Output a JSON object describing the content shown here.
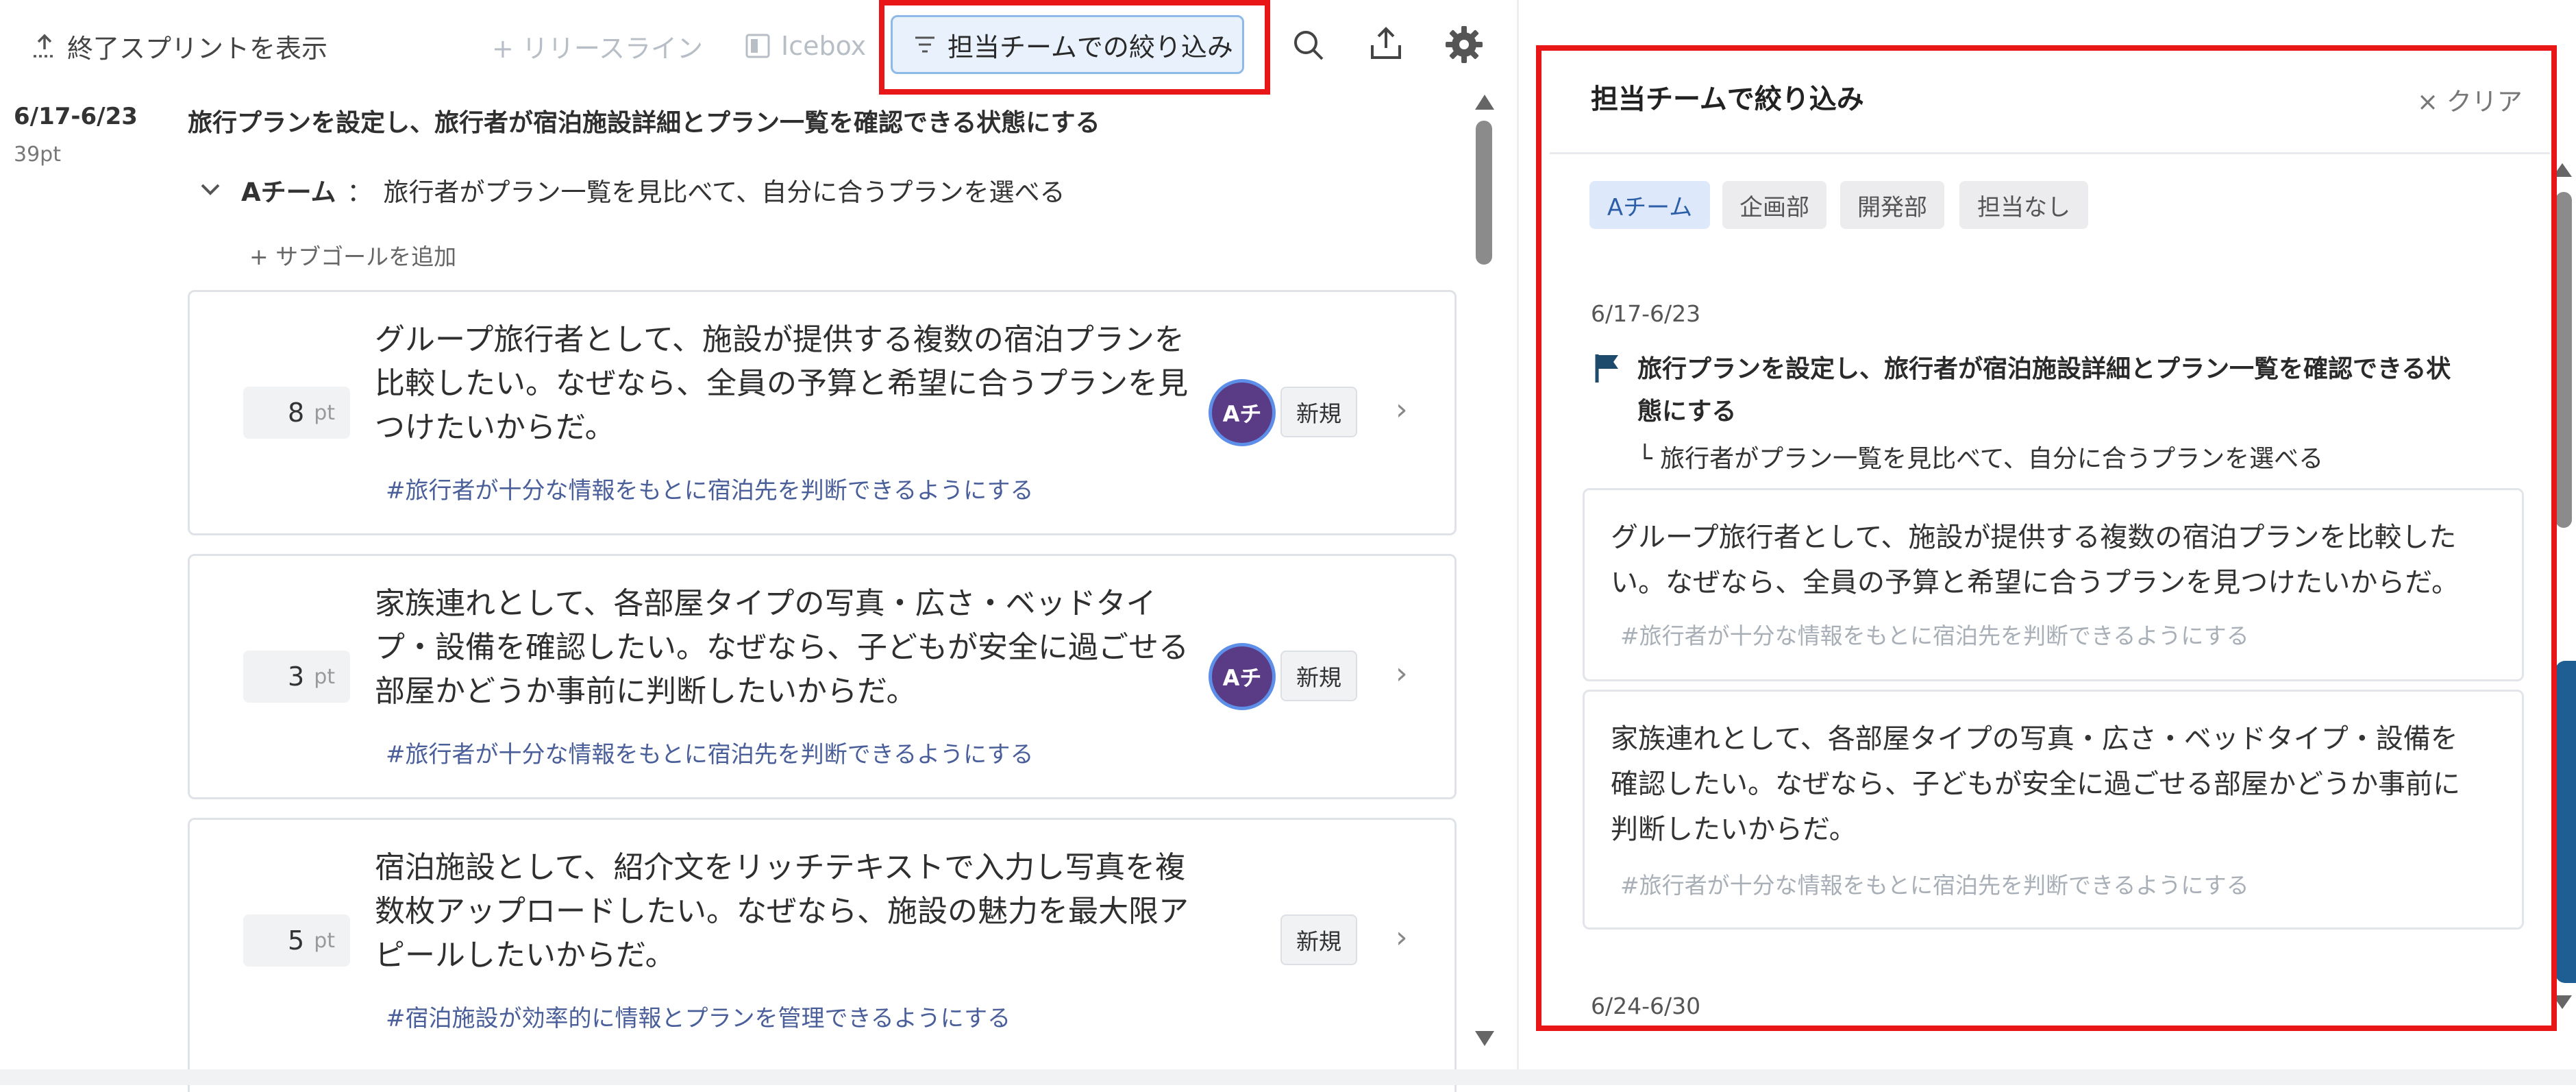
{
  "toolbar": {
    "show_finished": "終了スプリントを表示",
    "release_line": "+ リリースライン",
    "icebox": "Icebox",
    "team_filter": "担当チームでの絞り込み"
  },
  "sprint": {
    "date": "6/17-6/23",
    "points": "39pt",
    "goal": "旅行プランを設定し、旅行者が宿泊施設詳細とプラン一覧を確認できる状態にする",
    "subgoal_team": "Aチーム",
    "subgoal_sep": "：",
    "subgoal_text": "旅行者がプラン一覧を見比べて、自分に合うプランを選べる",
    "add_subgoal": "+ サブゴールを追加"
  },
  "stories": [
    {
      "points": "8",
      "unit": "pt",
      "line1": "グループ旅行者として、施設が提供する複数の宿泊プランを",
      "line2": "比較したい。なぜなら、全員の予算と希望に合うプランを見",
      "line3": "つけたいからだ。",
      "tag": "#旅行者が十分な情報をもとに宿泊先を判断できるようにする",
      "avatar": "Aチ",
      "status": "新規"
    },
    {
      "points": "3",
      "unit": "pt",
      "line1": "家族連れとして、各部屋タイプの写真・広さ・ベッドタイ",
      "line2": "プ・設備を確認したい。なぜなら、子どもが安全に過ごせる",
      "line3": "部屋かどうか事前に判断したいからだ。",
      "tag": "#旅行者が十分な情報をもとに宿泊先を判断できるようにする",
      "avatar": "Aチ",
      "status": "新規"
    },
    {
      "points": "5",
      "unit": "pt",
      "line1": "宿泊施設として、紹介文をリッチテキストで入力し写真を複",
      "line2": "数枚アップロードしたい。なぜなら、施設の魅力を最大限ア",
      "line3": "ピールしたいからだ。",
      "tag": "#宿泊施設が効率的に情報とプランを管理できるようにする",
      "status": "新規"
    }
  ],
  "panel": {
    "title": "担当チームで絞り込み",
    "clear": "× クリア",
    "chips": [
      "Aチーム",
      "企画部",
      "開発部",
      "担当なし"
    ],
    "date": "6/17-6/23",
    "goal_line1": "旅行プランを設定し、旅行者が宿泊施設詳細とプラン一覧を確認できる状",
    "goal_line2": "態にする",
    "subgoal": "└ 旅行者がプラン一覧を見比べて、自分に合うプランを選べる",
    "cards": [
      {
        "line1": "グループ旅行者として、施設が提供する複数の宿泊プランを比較した",
        "line2": "い。なぜなら、全員の予算と希望に合うプランを見つけたいからだ。",
        "line3": "",
        "tag": "#旅行者が十分な情報をもとに宿泊先を判断できるようにする"
      },
      {
        "line1": "家族連れとして、各部屋タイプの写真・広さ・ベッドタイプ・設備を",
        "line2": "確認したい。なぜなら、子どもが安全に過ごせる部屋かどうか事前に",
        "line3": "判断したいからだ。",
        "tag": "#旅行者が十分な情報をもとに宿泊先を判断できるようにする"
      }
    ],
    "next_date": "6/24-6/30"
  },
  "colors": {
    "highlight": "#e81616",
    "filter_active": "#e9f2fc",
    "chip_active": "#dde9fa",
    "avatar": "#5a3b86"
  }
}
